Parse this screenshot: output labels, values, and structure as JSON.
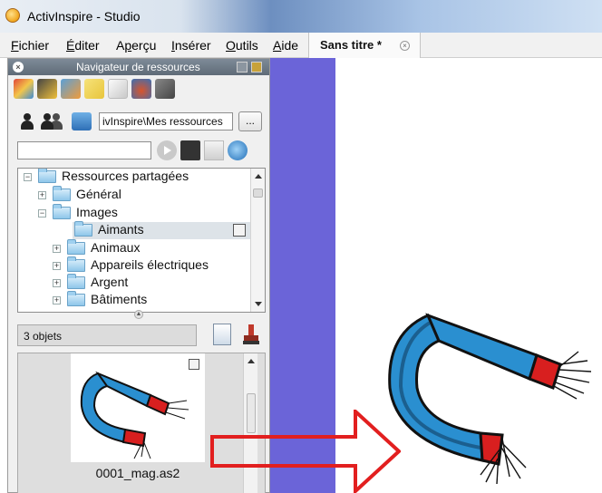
{
  "window": {
    "title": "ActivInspire - Studio"
  },
  "menu": {
    "items": [
      {
        "label": "Fichier",
        "accel_index": 0
      },
      {
        "label": "Éditer",
        "accel_index": 0
      },
      {
        "label": "Aperçu",
        "accel_index": 1
      },
      {
        "label": "Insérer",
        "accel_index": 0
      },
      {
        "label": "Outils",
        "accel_index": 0
      },
      {
        "label": "Aide",
        "accel_index": 0
      }
    ]
  },
  "document_tab": {
    "label": "Sans titre *",
    "close_icon": "close-icon"
  },
  "panel": {
    "title": "Navigateur de ressources",
    "path": "ivInspire\\Mes ressources",
    "path_button_label": "...",
    "search_value": "",
    "tree": [
      {
        "label": "Ressources partagées",
        "expander": "⊟",
        "depth": 0
      },
      {
        "label": "Général",
        "expander": "⊞",
        "depth": 1
      },
      {
        "label": "Images",
        "expander": "⊟",
        "depth": 1
      },
      {
        "label": "Aimants",
        "expander": "",
        "depth": 2,
        "selected": true
      },
      {
        "label": "Animaux",
        "expander": "⊞",
        "depth": 2
      },
      {
        "label": "Appareils électriques",
        "expander": "⊞",
        "depth": 2
      },
      {
        "label": "Argent",
        "expander": "⊞",
        "depth": 2
      },
      {
        "label": "Bâtiments",
        "expander": "⊞",
        "depth": 2
      }
    ],
    "object_count": "3 objets",
    "thumbnail_caption": "0001_mag.as2"
  },
  "colors": {
    "canvas_strip": "#6b64d8",
    "arrow": "#e21f1f",
    "magnet_blue": "#2a8fd0",
    "magnet_red": "#d81f1f"
  }
}
